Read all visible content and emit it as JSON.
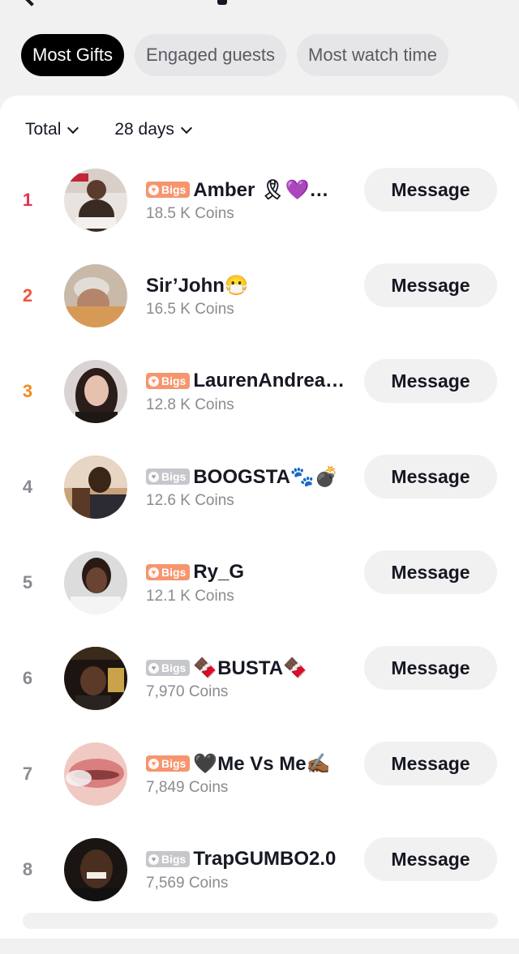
{
  "tabs": [
    {
      "label": "Most Gifts",
      "active": true
    },
    {
      "label": "Engaged guests",
      "active": false
    },
    {
      "label": "Most watch time",
      "active": false
    }
  ],
  "filters": {
    "scope": "Total",
    "period": "28 days"
  },
  "badge_label": "Bigs",
  "message_label": "Message",
  "colors": {
    "rank1": "#e8324f",
    "rank2": "#f0553c",
    "rank3": "#f5891f",
    "rank_default": "#8a8b91",
    "badge_orange": "#f6956e",
    "badge_gray": "#c6c7cc"
  },
  "leaderboard": [
    {
      "rank": "1",
      "badge": "orange",
      "name": "Amber 🎗💜…",
      "coins": "18.5 K Coins"
    },
    {
      "rank": "2",
      "badge": "none",
      "name": "Sir’John😷",
      "coins": "16.5 K Coins"
    },
    {
      "rank": "3",
      "badge": "orange",
      "name": "LaurenAndrea…",
      "coins": "12.8 K Coins"
    },
    {
      "rank": "4",
      "badge": "gray",
      "name": "BOOGSTA🐾💣",
      "coins": "12.6 K Coins"
    },
    {
      "rank": "5",
      "badge": "orange",
      "name": "Ry_G",
      "coins": "12.1 K Coins"
    },
    {
      "rank": "6",
      "badge": "gray",
      "name": "🍫BUSTA🍫",
      "coins": "7,970 Coins"
    },
    {
      "rank": "7",
      "badge": "orange",
      "name": "🖤Me Vs Me✍🏾",
      "coins": "7,849 Coins"
    },
    {
      "rank": "8",
      "badge": "gray",
      "name": "TrapGUMBO2.0",
      "coins": "7,569 Coins"
    }
  ]
}
